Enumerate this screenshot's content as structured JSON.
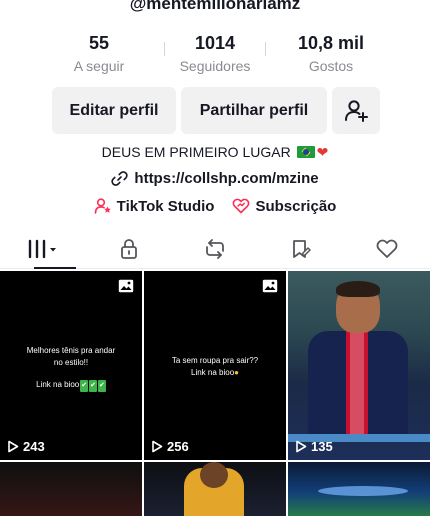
{
  "profile": {
    "username": "@mentemilionariamz",
    "stats": [
      {
        "value": "55",
        "label": "A seguir"
      },
      {
        "value": "1014",
        "label": "Seguidores"
      },
      {
        "value": "10,8 mil",
        "label": "Gostos"
      }
    ],
    "buttons": {
      "edit_label": "Editar perfil",
      "share_label": "Partilhar perfil"
    },
    "bio": "DEUS EM PRIMEIRO LUGAR",
    "link": "https://collshp.com/mzine",
    "studio_label": "TikTok Studio",
    "subscription_label": "Subscrição"
  },
  "tabs": [
    {
      "icon": "grid-icon",
      "active": true
    },
    {
      "icon": "lock-icon",
      "active": false
    },
    {
      "icon": "repost-icon",
      "active": false
    },
    {
      "icon": "bookmark-icon",
      "active": false
    },
    {
      "icon": "heart-icon",
      "active": false
    }
  ],
  "videos": [
    {
      "caption_line1": "Melhores tênis pra andar",
      "caption_line2": "no estilo!!",
      "caption_line3": "Link na bioo",
      "views": "243"
    },
    {
      "caption_line1": "Ta sem roupa pra sair??",
      "caption_line2": "Link na bioo",
      "views": "256"
    },
    {
      "views": "135"
    }
  ],
  "colors": {
    "text": "#161823",
    "secondary": "#8a8b91",
    "button_bg": "#f1f1f2",
    "studio_accent": "#fe2c55"
  }
}
